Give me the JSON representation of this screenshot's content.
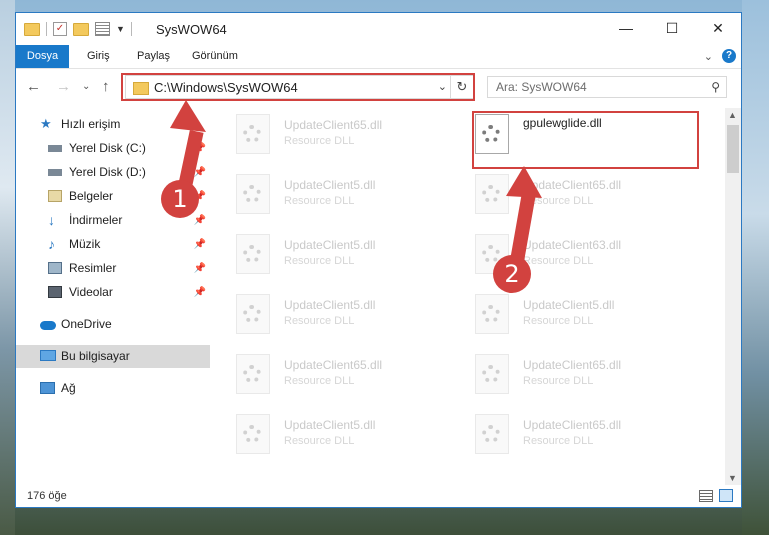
{
  "window": {
    "title": "SysWOW64"
  },
  "ribbon": {
    "tabs": [
      "Dosya",
      "Giriş",
      "Paylaş",
      "Görünüm"
    ],
    "help": "?"
  },
  "address": {
    "path": "C:\\Windows\\SysWOW64"
  },
  "search": {
    "placeholder": "Ara: SysWOW64"
  },
  "nav": {
    "items": [
      {
        "label": "Hızlı erişim",
        "icon": "star-icon"
      },
      {
        "label": "Yerel Disk (C:)",
        "icon": "drive-icon"
      },
      {
        "label": "Yerel Disk (D:)",
        "icon": "drive-icon"
      },
      {
        "label": "Belgeler",
        "icon": "documents-icon"
      },
      {
        "label": "İndirmeler",
        "icon": "download-icon"
      },
      {
        "label": "Müzik",
        "icon": "music-icon"
      },
      {
        "label": "Resimler",
        "icon": "pictures-icon"
      },
      {
        "label": "Videolar",
        "icon": "video-icon"
      },
      {
        "label": "OneDrive",
        "icon": "cloud-icon"
      },
      {
        "label": "Bu bilgisayar",
        "icon": "computer-icon"
      },
      {
        "label": "Ağ",
        "icon": "network-icon"
      }
    ]
  },
  "files": [
    {
      "name": "UpdateClient65.dll",
      "type": "Resource DLL"
    },
    {
      "name": "gpulewglide.dll",
      "type": ""
    },
    {
      "name": "UpdateClient5.dll",
      "type": "Resource DLL"
    },
    {
      "name": "UpdateClient65.dll",
      "type": "Resource DLL"
    },
    {
      "name": "UpdateClient5.dll",
      "type": "Resource DLL"
    },
    {
      "name": "UpdateClient63.dll",
      "type": "Resource DLL"
    },
    {
      "name": "UpdateClient5.dll",
      "type": "Resource DLL"
    },
    {
      "name": "UpdateClient5.dll",
      "type": "Resource DLL"
    },
    {
      "name": "UpdateClient65.dll",
      "type": "Resource DLL"
    },
    {
      "name": "UpdateClient65.dll",
      "type": "Resource DLL"
    },
    {
      "name": "UpdateClient5.dll",
      "type": "Resource DLL"
    },
    {
      "name": "UpdateClient65.dll",
      "type": "Resource DLL"
    }
  ],
  "status": {
    "count": "176 öğe"
  },
  "annotations": {
    "badge1": "1",
    "badge2": "2"
  },
  "colors": {
    "accent": "#1979ca",
    "highlight": "#d2423f"
  }
}
